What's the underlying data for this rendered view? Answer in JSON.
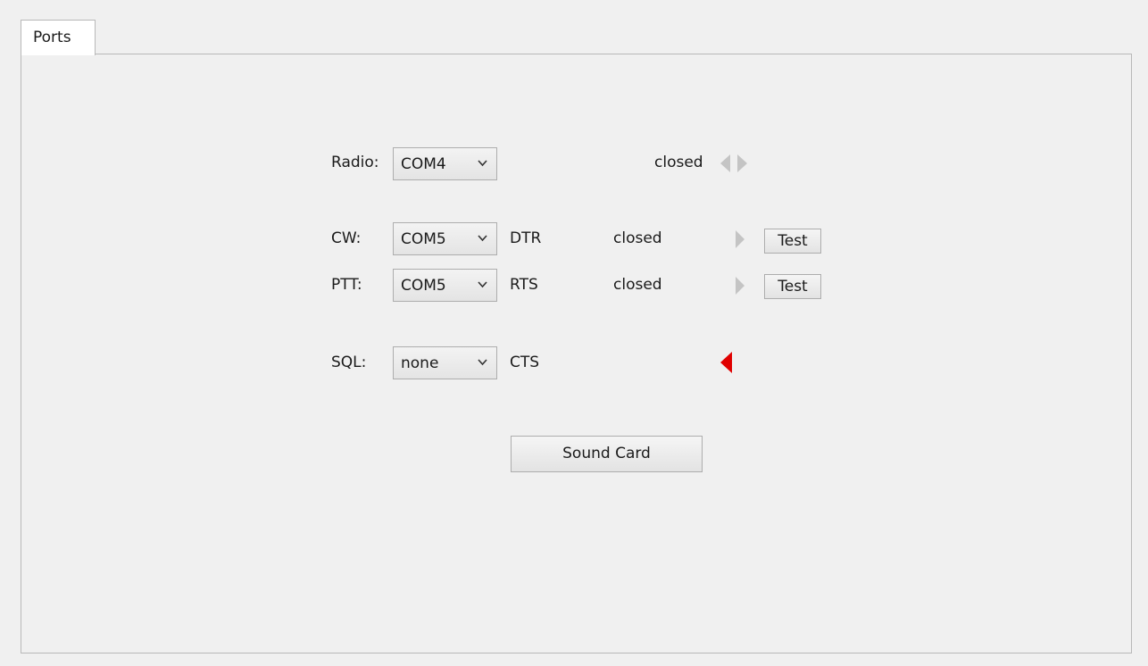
{
  "tabs": [
    {
      "label": "Ports"
    }
  ],
  "radio": {
    "label": "Radio:",
    "port": "COM4",
    "status": "closed"
  },
  "cw": {
    "label": "CW:",
    "port": "COM5",
    "line": "DTR",
    "status": "closed",
    "test_label": "Test"
  },
  "ptt": {
    "label": "PTT:",
    "port": "COM5",
    "line": "RTS",
    "status": "closed",
    "test_label": "Test"
  },
  "sql": {
    "label": "SQL:",
    "port": "none",
    "line": "CTS"
  },
  "sound_card_label": "Sound Card",
  "icons": {
    "dropdown": "chevron-down-icon",
    "rx_tx": "arrows-left-right-icon",
    "tx": "arrow-right-icon",
    "rx": "arrow-left-icon"
  },
  "colors": {
    "indicator_inactive": "#c4c4c4",
    "indicator_active": "#e00000"
  }
}
